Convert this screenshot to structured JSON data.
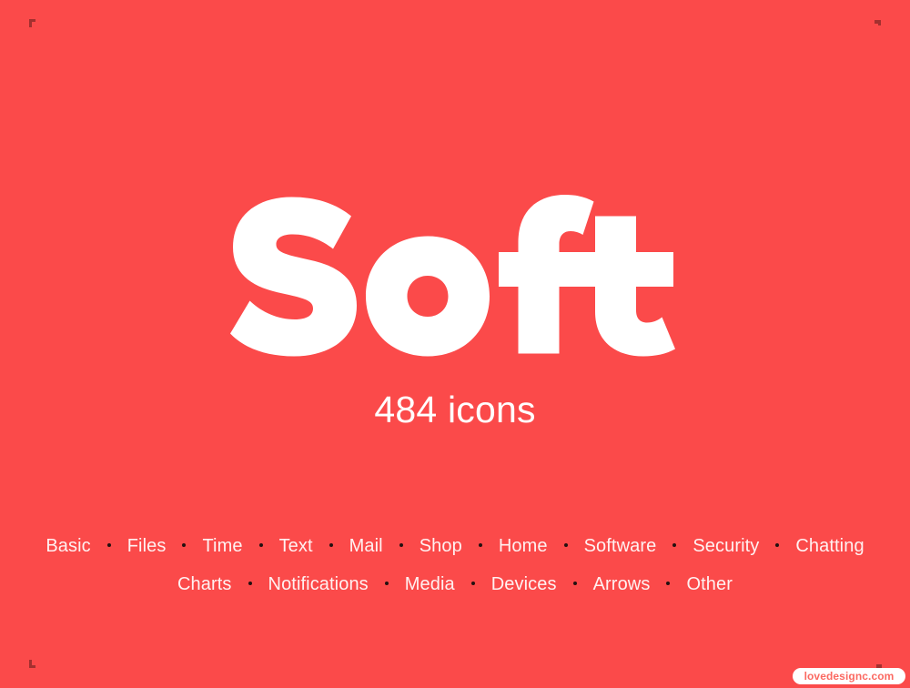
{
  "theme": {
    "background_color": "#fb4a4a",
    "text_color": "#ffffff",
    "separator_color": "#23100f",
    "watermark_background": "#ffffff",
    "watermark_text_color": "#fb6a62"
  },
  "hero": {
    "wordmark": "Soft",
    "subtitle": "484 icons"
  },
  "categories": {
    "separator": "•",
    "rows": [
      {
        "items": [
          {
            "label": "Basic"
          },
          {
            "label": "Files"
          },
          {
            "label": "Time"
          },
          {
            "label": "Text"
          },
          {
            "label": "Mail"
          },
          {
            "label": "Shop"
          },
          {
            "label": "Home"
          },
          {
            "label": "Software"
          },
          {
            "label": "Security"
          },
          {
            "label": "Chatting"
          }
        ]
      },
      {
        "items": [
          {
            "label": "Charts"
          },
          {
            "label": "Notifications"
          },
          {
            "label": "Media"
          },
          {
            "label": "Devices"
          },
          {
            "label": "Arrows"
          },
          {
            "label": "Other"
          }
        ]
      }
    ]
  },
  "watermark": {
    "label": "lovedesignc.com"
  }
}
